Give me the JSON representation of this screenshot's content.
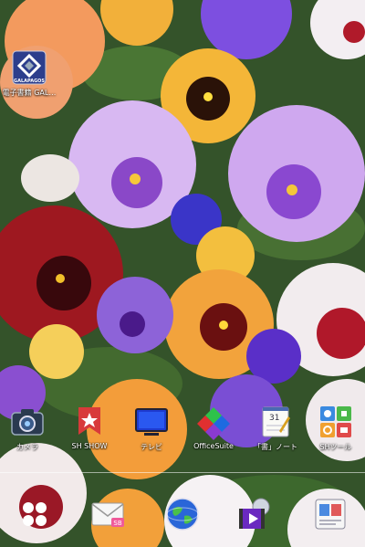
{
  "desktop": {
    "shortcut": {
      "label": "電子書籍 GAL…",
      "badge": "GALAPAGOS"
    }
  },
  "app_row": [
    {
      "label": "カメラ",
      "icon": "camera-icon"
    },
    {
      "label": "SH SHOW",
      "icon": "sh-show-icon"
    },
    {
      "label": "テレビ",
      "icon": "tv-icon"
    },
    {
      "label": "OfficeSuite",
      "icon": "officesuite-icon"
    },
    {
      "label": "「書」ノート",
      "icon": "note-icon",
      "badge": "31"
    },
    {
      "label": "SHツール",
      "icon": "sh-tools-icon"
    }
  ],
  "dock": [
    {
      "icon": "app-drawer-icon"
    },
    {
      "icon": "mail-icon",
      "badge": "SB"
    },
    {
      "icon": "browser-globe-icon"
    },
    {
      "icon": "media-player-icon"
    },
    {
      "icon": "contacts-icon"
    }
  ],
  "colors": {
    "wallpaper_foliage": "#3d5a2a",
    "pansy_purple": "#8b4fd6",
    "pansy_orange": "#f0a030",
    "pansy_red": "#a0141a",
    "pansy_white": "#f2eef2"
  }
}
